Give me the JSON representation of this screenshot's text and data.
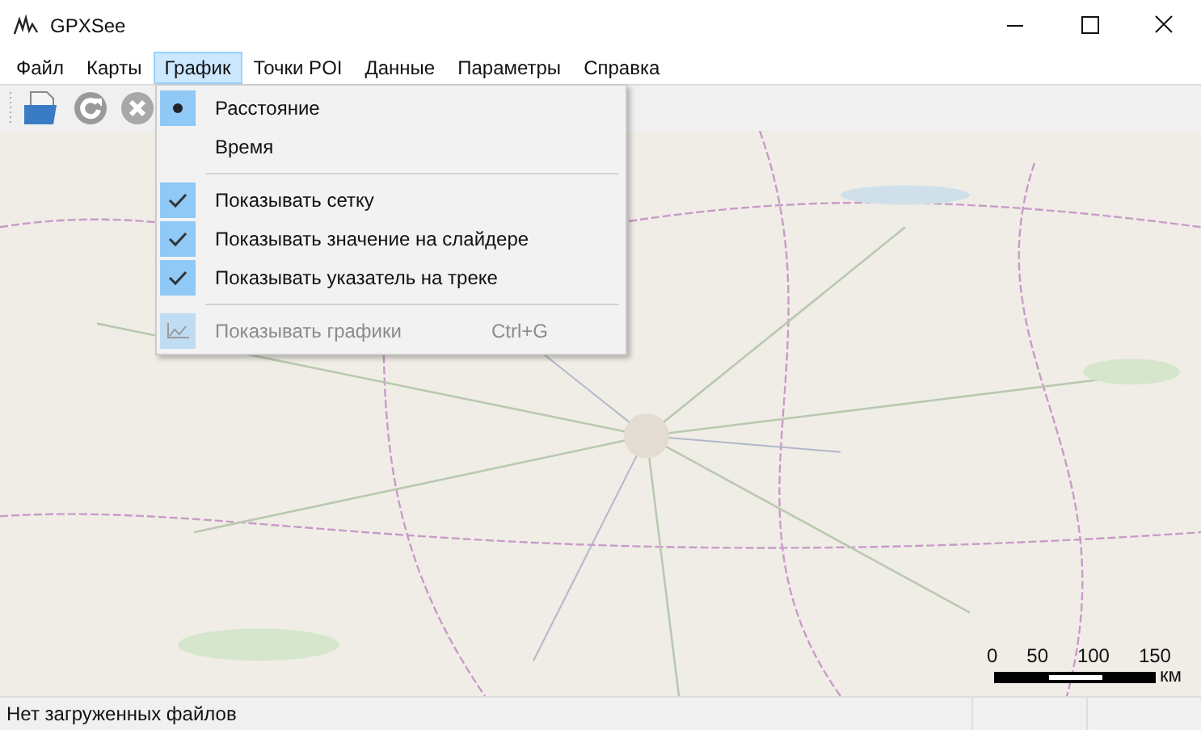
{
  "window": {
    "title": "GPXSee"
  },
  "menu_bar": [
    {
      "label": "Файл",
      "selected": false
    },
    {
      "label": "Карты",
      "selected": false
    },
    {
      "label": "График",
      "selected": true
    },
    {
      "label": "Точки POI",
      "selected": false
    },
    {
      "label": "Данные",
      "selected": false
    },
    {
      "label": "Параметры",
      "selected": false
    },
    {
      "label": "Справка",
      "selected": false
    }
  ],
  "menu": {
    "items": [
      {
        "kind": "radio",
        "label": "Расстояние",
        "selected": true
      },
      {
        "kind": "radio",
        "label": "Время",
        "selected": false
      },
      {
        "kind": "separator"
      },
      {
        "kind": "check",
        "label": "Показывать сетку",
        "checked": true
      },
      {
        "kind": "check",
        "label": "Показывать значение на слайдере",
        "checked": true
      },
      {
        "kind": "check",
        "label": "Показывать указатель на треке",
        "checked": true
      },
      {
        "kind": "separator"
      },
      {
        "kind": "action",
        "label": "Показывать графики",
        "shortcut": "Ctrl+G",
        "disabled": true
      }
    ]
  },
  "map": {
    "scale": {
      "ticks": [
        "0",
        "50",
        "100",
        "150"
      ],
      "unit": "км"
    }
  },
  "status_bar": {
    "text": "Нет загруженных файлов"
  }
}
